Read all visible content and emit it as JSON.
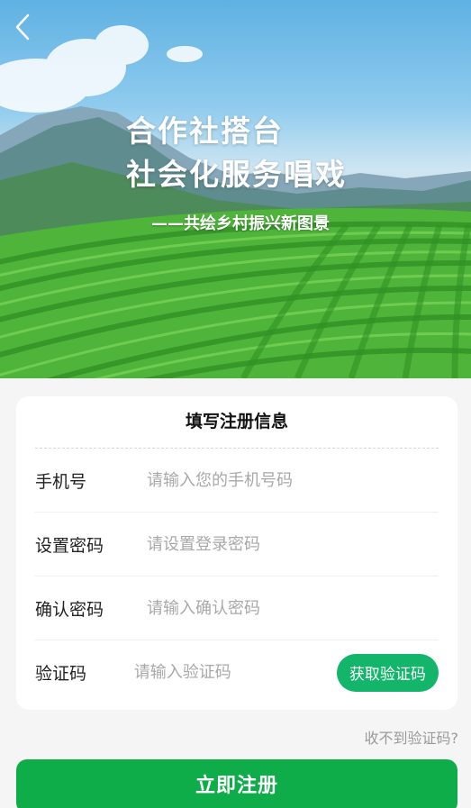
{
  "hero": {
    "slogan_line1": "合作社搭台",
    "slogan_line2": "社会化服务唱戏",
    "sub_slogan": "——共绘乡村振兴新图景",
    "icons": {
      "back": "chevron-left-icon"
    }
  },
  "form": {
    "title": "填写注册信息",
    "phone": {
      "label": "手机号",
      "placeholder": "请输入您的手机号码",
      "value": ""
    },
    "password": {
      "label": "设置密码",
      "placeholder": "请设置登录密码",
      "value": ""
    },
    "confirm": {
      "label": "确认密码",
      "placeholder": "请输入确认密码",
      "value": ""
    },
    "code": {
      "label": "验证码",
      "placeholder": "请输入验证码",
      "value": "",
      "button": "获取验证码"
    }
  },
  "help_link": "收不到验证码?",
  "submit_label": "立即注册",
  "colors": {
    "accent": "#0fad4a",
    "code_button": "#13b56a",
    "placeholder": "#a8a8a8",
    "background": "#f5f5f5"
  }
}
